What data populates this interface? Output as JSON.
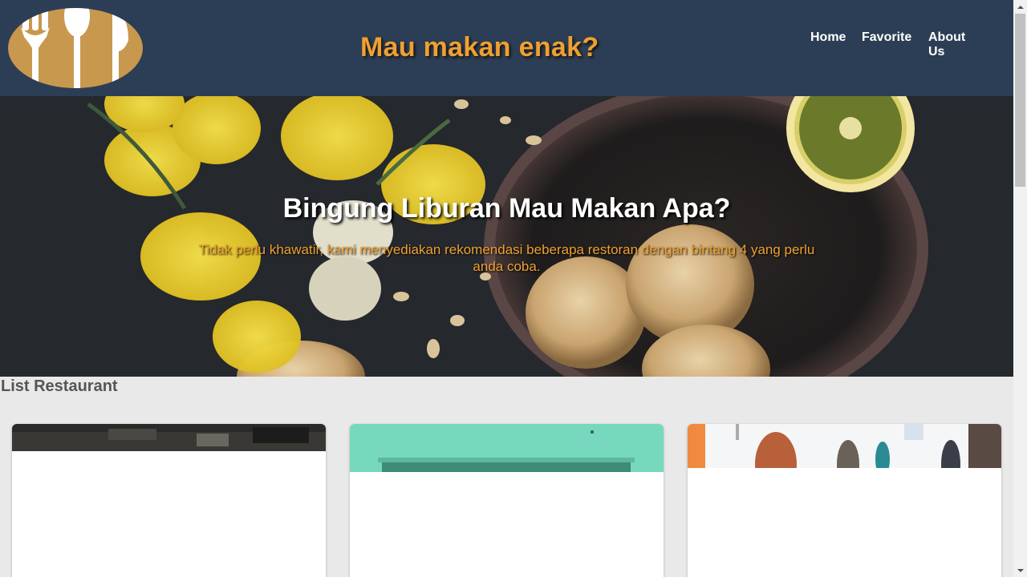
{
  "header": {
    "title": "Mau makan enak?",
    "logo_icon": "cutlery-logo-icon",
    "nav": [
      {
        "label": "Home"
      },
      {
        "label": "Favorite"
      },
      {
        "label": "About Us"
      }
    ]
  },
  "hero": {
    "title": "Bingung Liburan Mau Makan Apa?",
    "subtitle": "Tidak perlu khawatir, kami menyediakan rekomendasi beberapa restoran dengan bintang 4 yang perlu anda coba."
  },
  "list": {
    "title": "List Restaurant"
  },
  "colors": {
    "header_bg": "#2c3e55",
    "accent": "#f0a030",
    "logo_gold": "#c8984e",
    "page_bg": "#e9e9e9"
  }
}
